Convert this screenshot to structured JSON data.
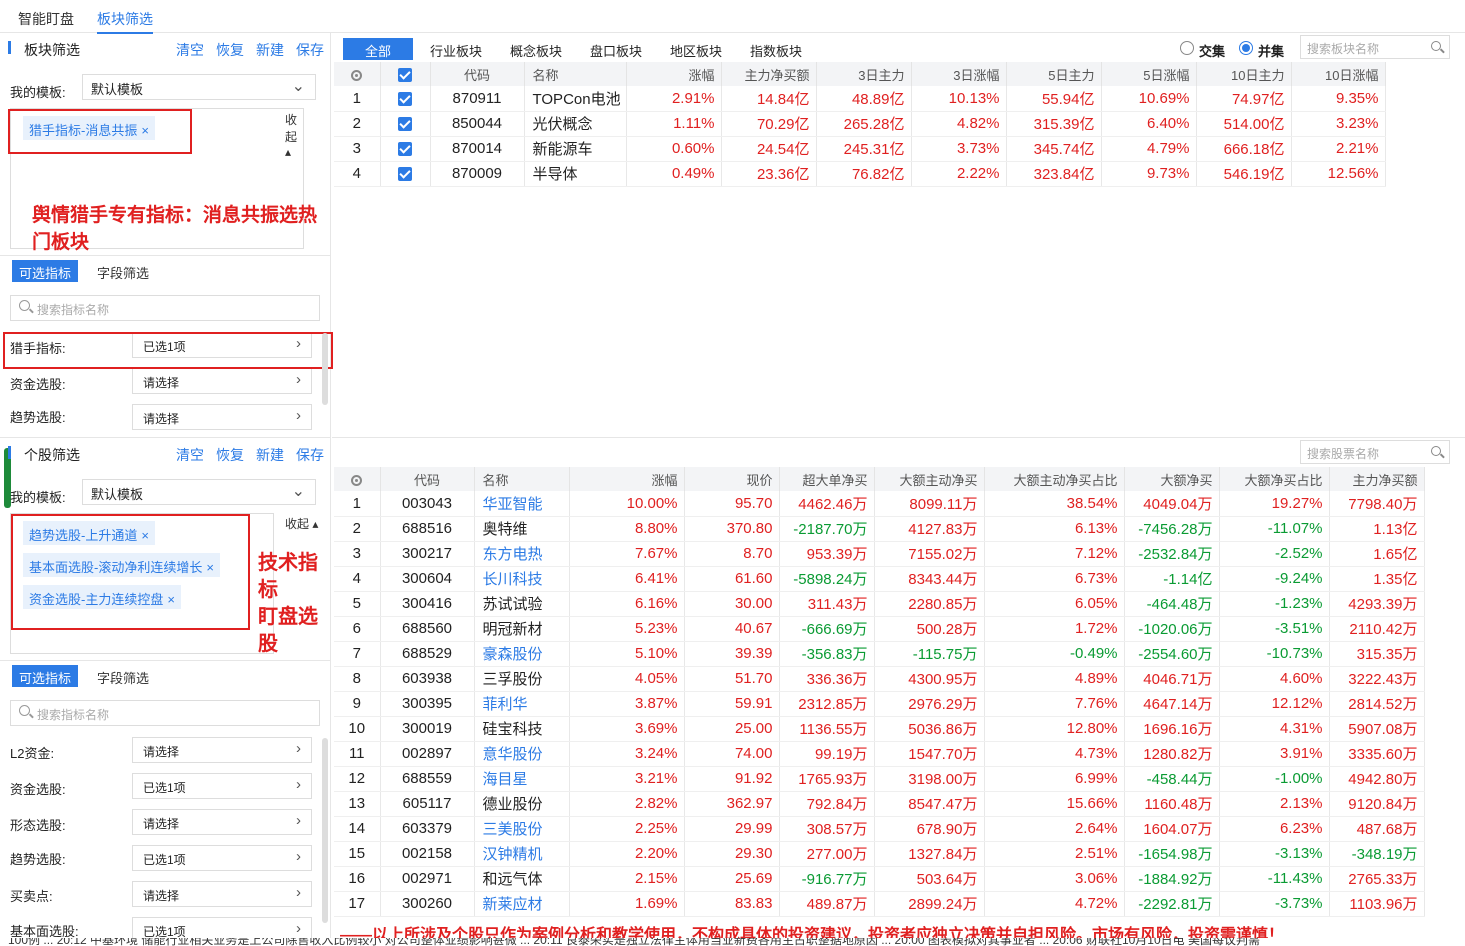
{
  "top_tabs": [
    {
      "label": "智能盯盘"
    },
    {
      "label": "板块筛选"
    }
  ],
  "sector_panel": {
    "title": "板块筛选",
    "actions": [
      "清空",
      "恢复",
      "新建",
      "保存"
    ],
    "template_label": "我的模板:",
    "template_value": "默认模板",
    "tags": [
      "猎手指标-消息共振"
    ],
    "collapse": "收起",
    "subtabs": [
      "可选指标",
      "字段筛选"
    ],
    "search_placeholder": "搜索指标名称",
    "filters": [
      {
        "label": "猎手指标:",
        "value": "已选1项"
      },
      {
        "label": "资金选股:",
        "value": "请选择"
      },
      {
        "label": "趋势选股:",
        "value": "请选择"
      }
    ]
  },
  "stock_panel": {
    "title": "个股筛选",
    "actions": [
      "清空",
      "恢复",
      "新建",
      "保存"
    ],
    "template_label": "我的模板:",
    "template_value": "默认模板",
    "tags": [
      "趋势选股-上升通道",
      "基本面选股-滚动净利连续增长",
      "资金选股-主力连续控盘"
    ],
    "collapse": "收起",
    "subtabs": [
      "可选指标",
      "字段筛选"
    ],
    "search_placeholder": "搜索指标名称",
    "filters": [
      {
        "label": "L2资金:",
        "value": "请选择"
      },
      {
        "label": "资金选股:",
        "value": "已选1项"
      },
      {
        "label": "形态选股:",
        "value": "请选择"
      },
      {
        "label": "趋势选股:",
        "value": "已选1项"
      },
      {
        "label": "买卖点:",
        "value": "请选择"
      },
      {
        "label": "基本面选股:",
        "value": "已选1项"
      }
    ]
  },
  "annotations": {
    "sector_note": "舆情猎手专有指标：消息共振选热门板块",
    "stock_note_line1": "技术指标",
    "stock_note_line2": "盯盘选股",
    "disclaimer": "——以上所涉及个股只作为案例分析和教学使用，不构成具体的投资建议，投资者应独立决策并自担风险。市场有风险，投资需谨慎！"
  },
  "sector_tabs": [
    "全部",
    "行业板块",
    "概念板块",
    "盘口板块",
    "地区板块",
    "指数板块"
  ],
  "sector_mode": {
    "options": [
      "交集",
      "并集"
    ],
    "selected": "并集"
  },
  "sector_search_placeholder": "搜索板块名称",
  "sector_table": {
    "columns": [
      "",
      "",
      "代码",
      "名称",
      "涨幅",
      "主力净买额",
      "3日主力",
      "3日涨幅",
      "5日主力",
      "5日涨幅",
      "10日主力",
      "10日涨幅"
    ],
    "rows": [
      [
        "1",
        "870911",
        "TOPCon电池",
        "2.91%",
        "14.84亿",
        "48.89亿",
        "10.13%",
        "55.94亿",
        "10.69%",
        "74.97亿",
        "9.35%"
      ],
      [
        "2",
        "850044",
        "光伏概念",
        "1.11%",
        "70.29亿",
        "265.28亿",
        "4.82%",
        "315.39亿",
        "6.40%",
        "514.00亿",
        "3.23%"
      ],
      [
        "3",
        "870014",
        "新能源车",
        "0.60%",
        "24.54亿",
        "245.31亿",
        "3.73%",
        "345.74亿",
        "4.79%",
        "666.18亿",
        "2.21%"
      ],
      [
        "4",
        "870009",
        "半导体",
        "0.49%",
        "23.36亿",
        "76.82亿",
        "2.22%",
        "323.84亿",
        "9.73%",
        "546.19亿",
        "12.56%"
      ]
    ]
  },
  "stock_search_placeholder": "搜索股票名称",
  "stock_table": {
    "columns": [
      "",
      "代码",
      "名称",
      "涨幅",
      "现价",
      "超大单净买",
      "大额主动净买",
      "大额主动净买占比",
      "大额净买",
      "大额净买占比",
      "主力净买额"
    ],
    "rows": [
      [
        "1",
        "003043",
        "华亚智能",
        "10.00%",
        "95.70",
        "4462.46万",
        "8099.11万",
        "38.54%",
        "4049.04万",
        "19.27%",
        "7798.40万"
      ],
      [
        "2",
        "688516",
        "奥特维",
        "8.80%",
        "370.80",
        "-2187.70万",
        "4127.83万",
        "6.13%",
        "-7456.28万",
        "-11.07%",
        "1.13亿"
      ],
      [
        "3",
        "300217",
        "东方电热",
        "7.67%",
        "8.70",
        "953.39万",
        "7155.02万",
        "7.12%",
        "-2532.84万",
        "-2.52%",
        "1.65亿"
      ],
      [
        "4",
        "300604",
        "长川科技",
        "6.41%",
        "61.60",
        "-5898.24万",
        "8343.44万",
        "6.73%",
        "-1.14亿",
        "-9.24%",
        "1.35亿"
      ],
      [
        "5",
        "300416",
        "苏试试验",
        "6.16%",
        "30.00",
        "311.43万",
        "2280.85万",
        "6.05%",
        "-464.48万",
        "-1.23%",
        "4293.39万"
      ],
      [
        "6",
        "688560",
        "明冠新材",
        "5.23%",
        "40.67",
        "-666.69万",
        "500.28万",
        "1.72%",
        "-1020.06万",
        "-3.51%",
        "2110.42万"
      ],
      [
        "7",
        "688529",
        "豪森股份",
        "5.10%",
        "39.39",
        "-356.83万",
        "-115.75万",
        "-0.49%",
        "-2554.60万",
        "-10.73%",
        "315.35万"
      ],
      [
        "8",
        "603938",
        "三孚股份",
        "4.05%",
        "51.70",
        "336.36万",
        "4300.95万",
        "4.89%",
        "4046.71万",
        "4.60%",
        "3222.43万"
      ],
      [
        "9",
        "300395",
        "菲利华",
        "3.87%",
        "59.91",
        "2312.85万",
        "2976.29万",
        "7.76%",
        "4647.14万",
        "12.12%",
        "2814.52万"
      ],
      [
        "10",
        "300019",
        "硅宝科技",
        "3.69%",
        "25.00",
        "1136.55万",
        "5036.86万",
        "12.80%",
        "1696.16万",
        "4.31%",
        "5907.08万"
      ],
      [
        "11",
        "002897",
        "意华股份",
        "3.24%",
        "74.00",
        "99.19万",
        "1547.70万",
        "4.73%",
        "1280.82万",
        "3.91%",
        "3335.60万"
      ],
      [
        "12",
        "688559",
        "海目星",
        "3.21%",
        "91.92",
        "1765.93万",
        "3198.00万",
        "6.99%",
        "-458.44万",
        "-1.00%",
        "4942.80万"
      ],
      [
        "13",
        "605117",
        "德业股份",
        "2.82%",
        "362.97",
        "792.84万",
        "8547.47万",
        "15.66%",
        "1160.48万",
        "2.13%",
        "9120.84万"
      ],
      [
        "14",
        "603379",
        "三美股份",
        "2.25%",
        "29.99",
        "308.57万",
        "678.90万",
        "2.64%",
        "1604.07万",
        "6.23%",
        "487.68万"
      ],
      [
        "15",
        "002158",
        "汉钟精机",
        "2.20%",
        "29.30",
        "277.00万",
        "1327.84万",
        "2.51%",
        "-1654.98万",
        "-3.13%",
        "-348.19万"
      ],
      [
        "16",
        "002971",
        "和远气体",
        "2.15%",
        "25.69",
        "-916.77万",
        "503.64万",
        "3.06%",
        "-1884.92万",
        "-11.43%",
        "2765.33万"
      ],
      [
        "17",
        "300260",
        "新莱应材",
        "1.69%",
        "83.83",
        "489.87万",
        "2899.24万",
        "4.72%",
        "-2292.81万",
        "-3.73%",
        "1103.96万"
      ]
    ],
    "blue_names": [
      "华亚智能",
      "东方电热",
      "长川科技",
      "豪森股份",
      "菲利华",
      "意华股份",
      "海目星",
      "三美股份",
      "汉钟精机",
      "新莱应材"
    ]
  },
  "ticker": "100例 ...   20:12 中基环境 储能行业相关业务是上公司除售收入比例较小 对公司整体业绩影响甚微 ...   20:11 良泰荣实是独立法律主体用当业新费各用主占职整据地原因 ...   20:00 图表模拟对其事业者 ...   20:06 财联社10月10日电 美国每议判需"
}
